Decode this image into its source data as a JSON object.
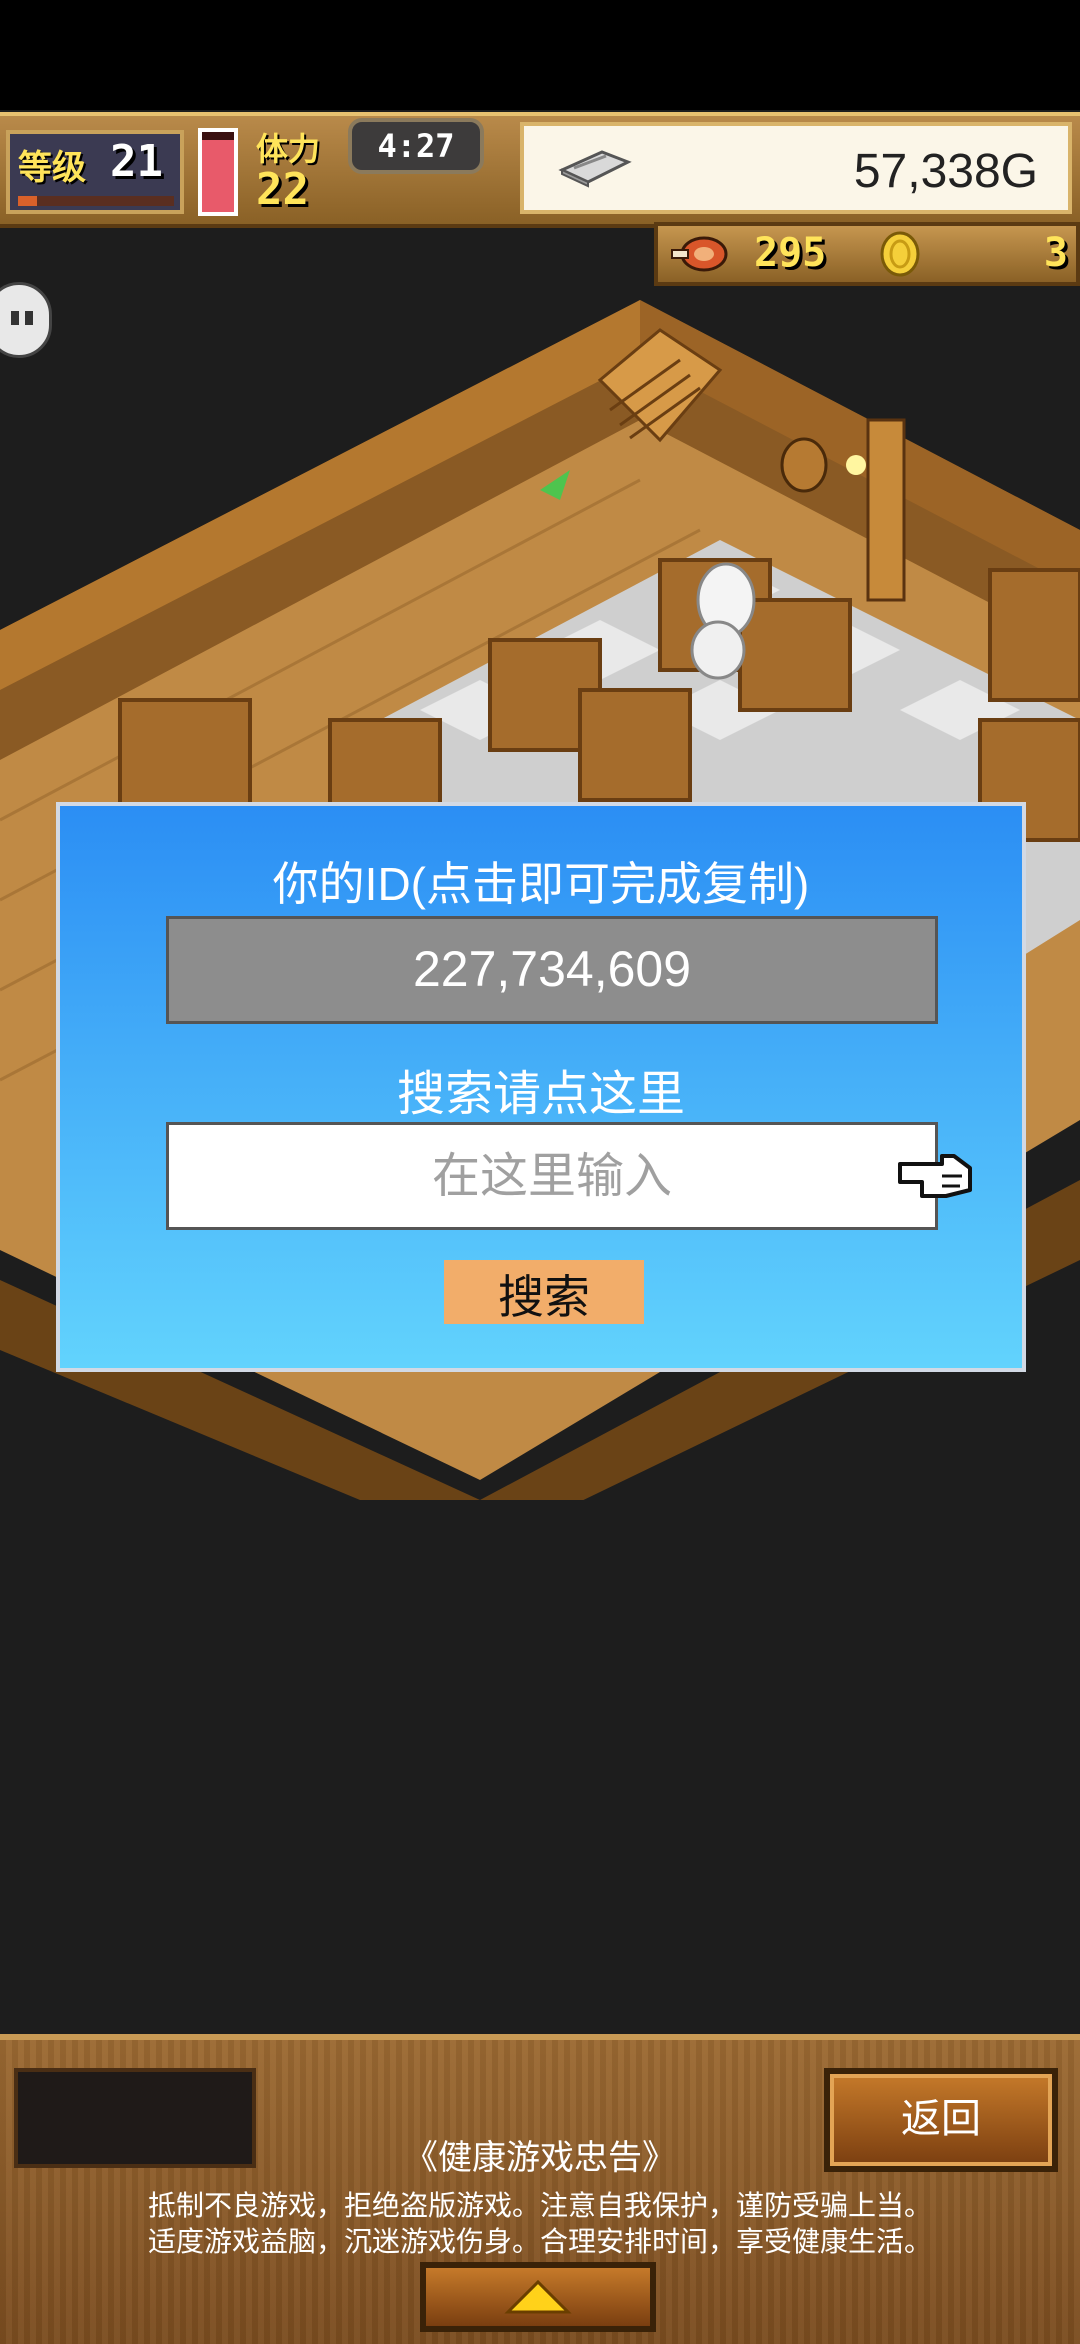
{
  "hud": {
    "level_label": "等级",
    "level_value": "21",
    "level_progress": 0.12,
    "stamina_label": "体力",
    "stamina_value": "22",
    "stamina_fill": 0.9,
    "time": "4:27",
    "gold": "57,338G",
    "food": "295",
    "coins": "3"
  },
  "dialog": {
    "id_title": "你的ID(点击即可完成复制)",
    "id_value": "227,734,609",
    "search_title": "搜索请点这里",
    "search_placeholder": "在这里输入",
    "search_button": "搜索"
  },
  "footer": {
    "back_button": "返回",
    "health_title": "《健康游戏忠告》",
    "health_line1": "抵制不良游戏，拒绝盗版游戏。注意自我保护，谨防受骗上当。",
    "health_line2": "适度游戏益脑，沉迷游戏伤身。合理安排时间，享受健康生活。"
  },
  "colors": {
    "dialog_top": "#2b8ef4",
    "dialog_bottom": "#62d3fd",
    "button_orange": "#f2ad6a",
    "hud_brown": "#8a6126"
  }
}
